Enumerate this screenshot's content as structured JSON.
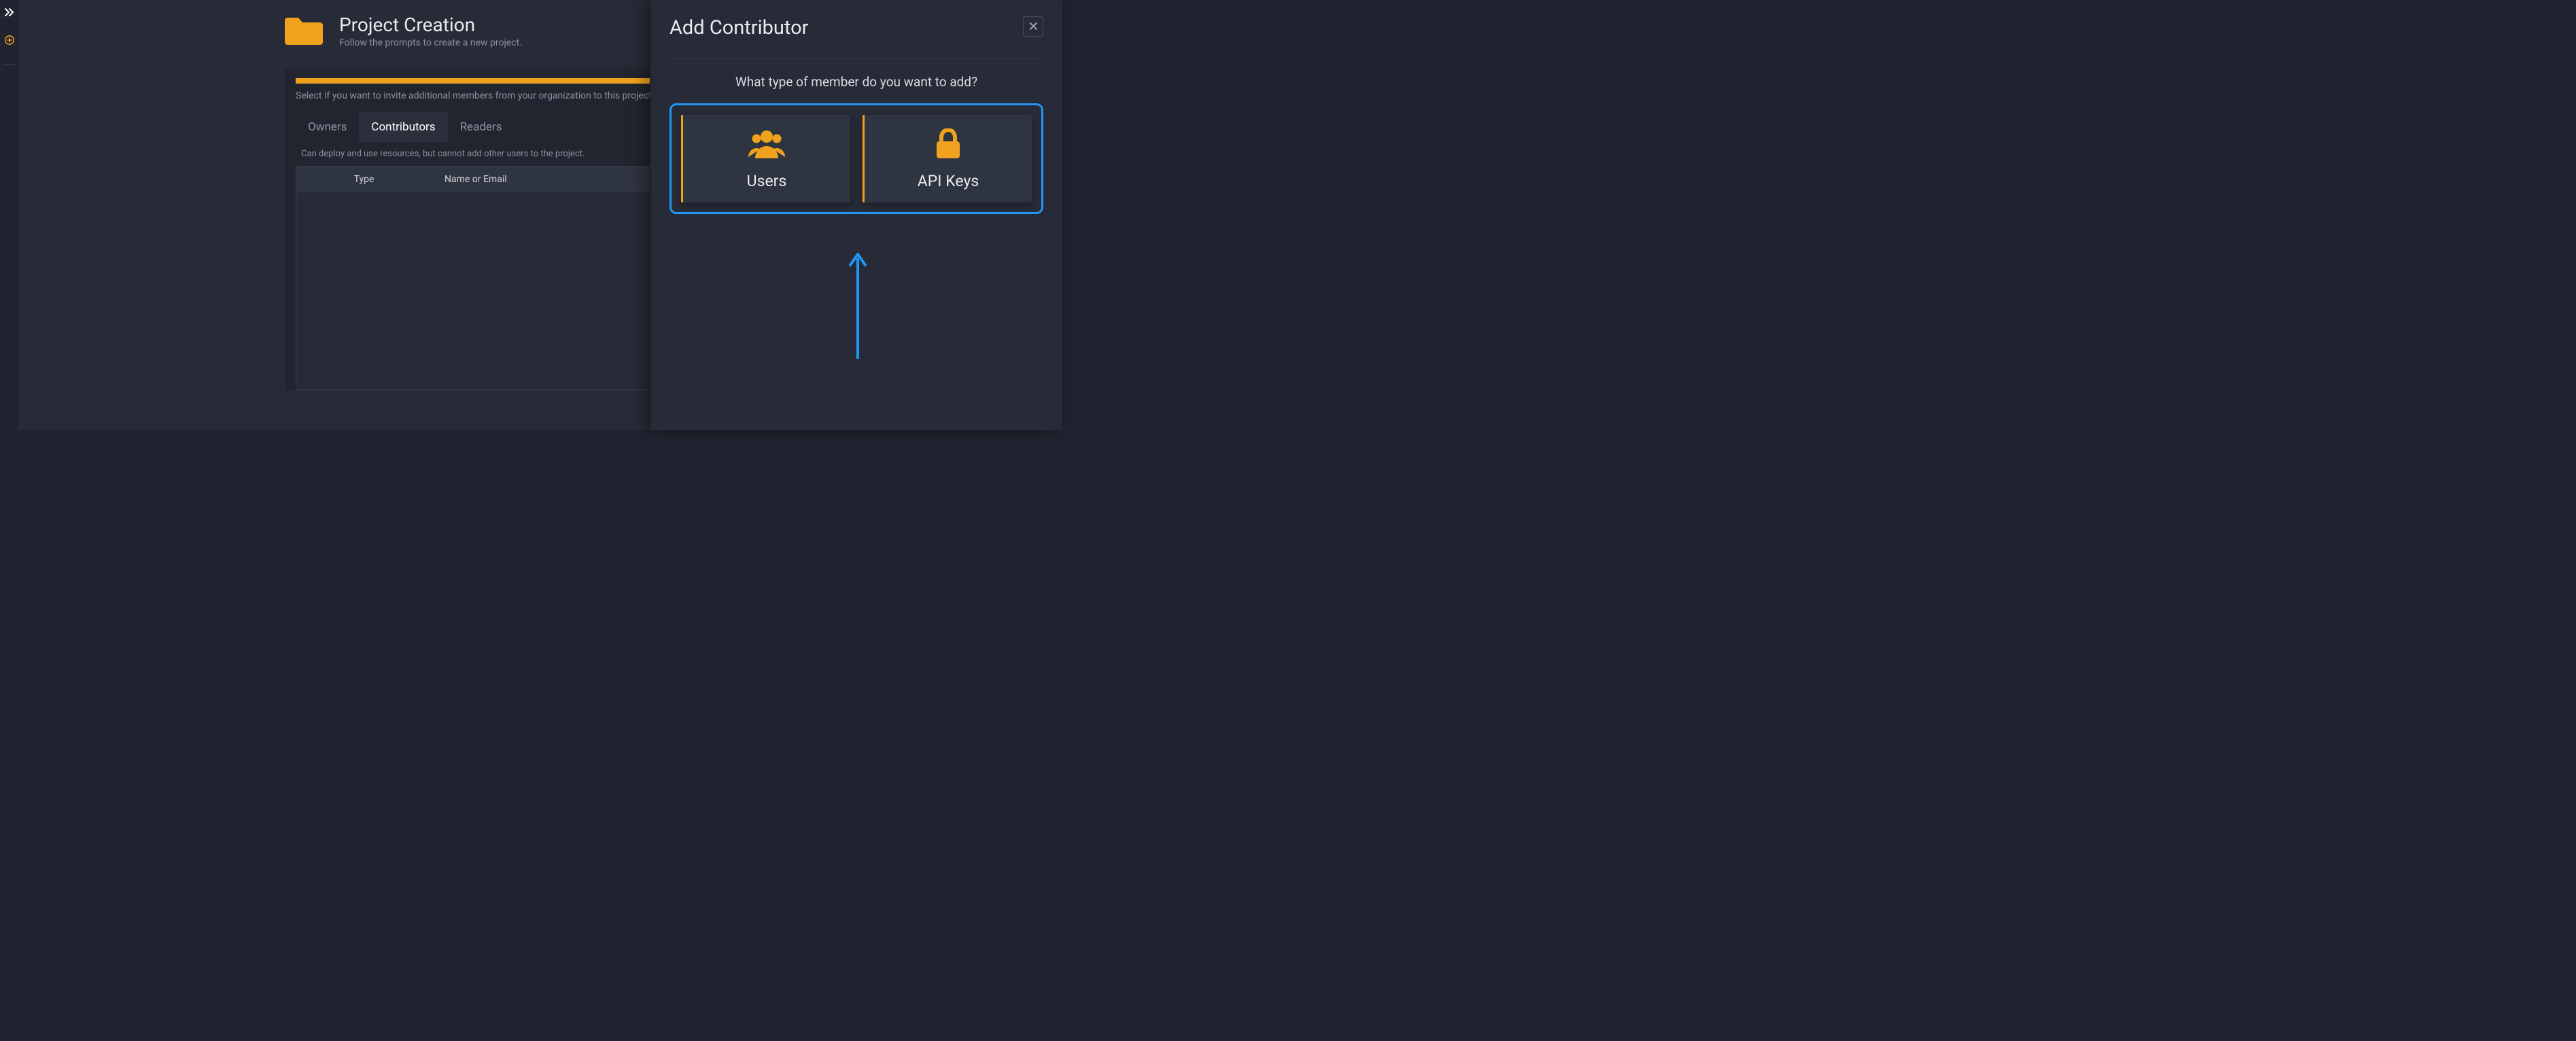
{
  "sidebar": {
    "expand_icon": "chevron-double-right",
    "add_icon": "plus-circle"
  },
  "page": {
    "title": "Project Creation",
    "subtitle": "Follow the prompts to create a new project."
  },
  "wizard": {
    "step_description": "Select if you want to invite additional members from your organization to this project, and the",
    "tabs": [
      {
        "label": "Owners",
        "active": false
      },
      {
        "label": "Contributors",
        "active": true
      },
      {
        "label": "Readers",
        "active": false
      }
    ],
    "tab_info": "Can deploy and use resources, but cannot add other users to the project.",
    "columns": {
      "type": "Type",
      "name": "Name or Email"
    }
  },
  "panel": {
    "title": "Add Contributor",
    "close_label": "✖",
    "question": "What type of member do you want to add?",
    "options": [
      {
        "id": "users",
        "label": "Users",
        "icon": "users"
      },
      {
        "id": "api-keys",
        "label": "API Keys",
        "icon": "lock"
      }
    ]
  },
  "colors": {
    "accent": "#f0a21f",
    "highlight": "#2196f3"
  }
}
